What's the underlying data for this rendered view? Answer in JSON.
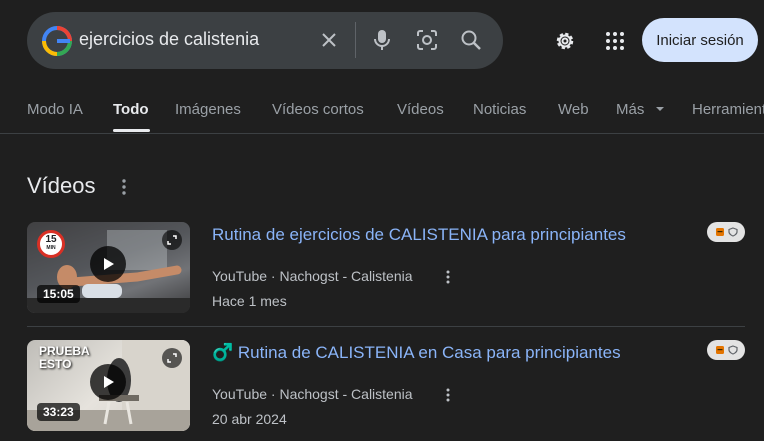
{
  "search": {
    "query": "ejercicios de calistenia",
    "icons": [
      "google-logo",
      "clear-icon",
      "mic-icon",
      "lens-icon",
      "search-icon"
    ]
  },
  "header": {
    "settings_icon": "gear-icon",
    "apps_icon": "apps-grid-icon",
    "signin_label": "Iniciar sesión"
  },
  "tabs": [
    {
      "label": "Modo IA"
    },
    {
      "label": "Todo",
      "active": true
    },
    {
      "label": "Imágenes"
    },
    {
      "label": "Vídeos cortos"
    },
    {
      "label": "Vídeos"
    },
    {
      "label": "Noticias"
    },
    {
      "label": "Web"
    },
    {
      "label": "Más"
    },
    {
      "label": "Herramientas"
    }
  ],
  "section": {
    "title": "Vídeos"
  },
  "videos": [
    {
      "title": "Rutina de ejercicios de CALISTENIA para principiantes",
      "source": "YouTube · Nachogst - Calistenia",
      "date": "Hace 1 mes",
      "duration": "15:05",
      "thumb_badge_top": "15",
      "thumb_badge_bottom": "MIN"
    },
    {
      "title": "♂️ Rutina de CALISTENIA en Casa para principiantes",
      "source": "YouTube · Nachogst - Calistenia",
      "date": "20 abr 2024",
      "duration": "33:23",
      "thumb_text": "PRUEBA\nESTO"
    }
  ],
  "colors": {
    "background": "#1f1f1f",
    "link": "#8ab4f8",
    "signin_bg": "#d3e3fd"
  }
}
